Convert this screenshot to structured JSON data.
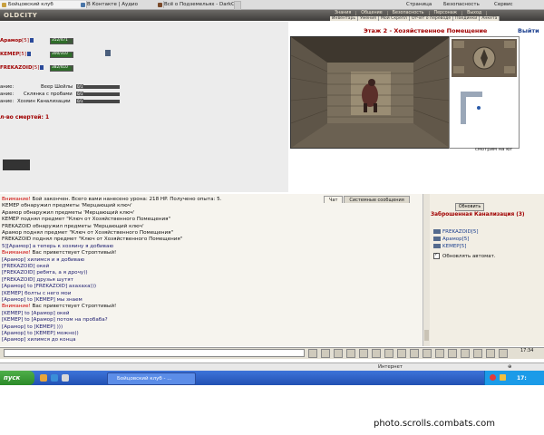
{
  "browser": {
    "tabs": [
      {
        "label": "Бойцовский клуб",
        "active": true
      },
      {
        "label": "В Контакте | Аудио",
        "active": false
      },
      {
        "label": "Всё о Подземельях - DarkCl...",
        "active": false
      }
    ],
    "menu": [
      "Страница",
      "Безопасность",
      "Сервис"
    ]
  },
  "game": {
    "logo": "OLDCITY",
    "top_nav": [
      "Знания",
      "Общение",
      "Безопасность",
      "Персонаж",
      "Выход"
    ],
    "sub_nav": [
      "Инвентарь",
      "Умения",
      "Мой Скрепл",
      "Отчет о переводе",
      "Поединки",
      "Анкета"
    ],
    "players": [
      {
        "name": "Арамор",
        "level": "[5]",
        "hp": "352/471",
        "hp_fraction": 0.75
      },
      {
        "name": "KEMEP",
        "level": "[5]",
        "hp": "300/310",
        "hp_fraction": 0.97
      },
      {
        "name": "FREKAZOID",
        "level": "[5]",
        "hp": "382/410",
        "hp_fraction": 0.93
      }
    ],
    "tasks": [
      {
        "label": "ание:",
        "value": "Веер Шейлы",
        "badge": "0/1"
      },
      {
        "label": "ание:",
        "value": "Склянка с пробами",
        "badge": "0/1"
      },
      {
        "label": "ание:",
        "value": "Хозяин Канализации",
        "badge": "0/1"
      }
    ],
    "deaths": "л-во смертей: 1",
    "location_title": "Этаж 2 - Хозяйственное Помещение",
    "exit": "Выйти",
    "facing": "смотрим на юг",
    "chat_tabs": [
      "Чат",
      "Системные сообщения"
    ],
    "chat_lines": [
      {
        "time": "",
        "prefix": "Внимание!",
        "text": " Бой закончен. Всего вами нанесено урона: 218 HP. Получено опыта: 5."
      },
      {
        "time": "",
        "prefix": "",
        "text": "КЕМЕР обнаружил предметы 'Мерцающий ключ'"
      },
      {
        "time": "",
        "prefix": "",
        "text": "Арамор обнаружил предметы 'Мерцающий ключ'"
      },
      {
        "time": "",
        "prefix": "",
        "text": "KEMEP поднял предмет \"Ключ от Хозяйственного Помещения\""
      },
      {
        "time": "",
        "prefix": "",
        "text": "FREKAZOID обнаружил предметы 'Мерцающий ключ'"
      },
      {
        "time": "",
        "prefix": "",
        "text": "Арамор поднял предмет \"Ключ от Хозяйственного Помещения\""
      },
      {
        "time": "",
        "prefix": "",
        "text": "FREKAZOID поднял предмет \"Ключ от Хозяйственного Помещения\""
      },
      {
        "time": "5]",
        "prefix": "",
        "text": "[Арамор] а теперь к хозяину я добиваю"
      },
      {
        "time": "",
        "prefix": "Внимание!",
        "text": " Вас приветствует Строптивый!"
      },
      {
        "time": "",
        "prefix": "",
        "text": "[Арамор] хилимся и я добиваю"
      },
      {
        "time": "",
        "prefix": "",
        "text": "[FREKAZOID] окей"
      },
      {
        "time": "",
        "prefix": "",
        "text": "[FREKAZOID] ребята, а я дрочу))"
      },
      {
        "time": "",
        "prefix": "",
        "text": "[FREKAZOID] друзья шутят"
      },
      {
        "time": "",
        "prefix": "",
        "text": "[Арамор] to [FREKAZOID] ахахаха)))"
      },
      {
        "time": "",
        "prefix": "",
        "text": "[KEMEP] болты с него мои"
      },
      {
        "time": "",
        "prefix": "",
        "text": "[Арамор] to [KEMEP] мы знаем"
      },
      {
        "time": "",
        "prefix": "Внимание!",
        "text": " Вас приветствует Строптивый!"
      },
      {
        "time": "",
        "prefix": "",
        "text": "[KEMEP] to [Арамор] окей"
      },
      {
        "time": "",
        "prefix": "",
        "text": "[KEMEP] to [Арамор] потом на пробаба?"
      },
      {
        "time": "",
        "prefix": "",
        "text": "[Арамор] to [KEMEP] )))"
      },
      {
        "time": "",
        "prefix": "",
        "text": "[Арамор] to [KEMEP] можно))"
      },
      {
        "time": "",
        "prefix": "",
        "text": "[Арамор] хилимся до конца"
      }
    ],
    "refresh": "Обновить",
    "location_name": "Заброшенная Канализация (3)",
    "members": [
      "FREKAZOID[5]",
      "Арамор[5]",
      "KEMEP[5]"
    ],
    "autoupdate": "Обновлять автомат.",
    "clock": "17:34"
  },
  "statusbar": {
    "zone": "Интернет"
  },
  "taskbar": {
    "start": "пуск",
    "window": "Бойцовский клуб - ...",
    "tray_clock": "17:"
  },
  "watermark": "photo.scrolls.combats.com",
  "colors": {
    "accent_red": "#a00000",
    "link_blue": "#1a3e8e",
    "taskbar": "#2251b3"
  }
}
